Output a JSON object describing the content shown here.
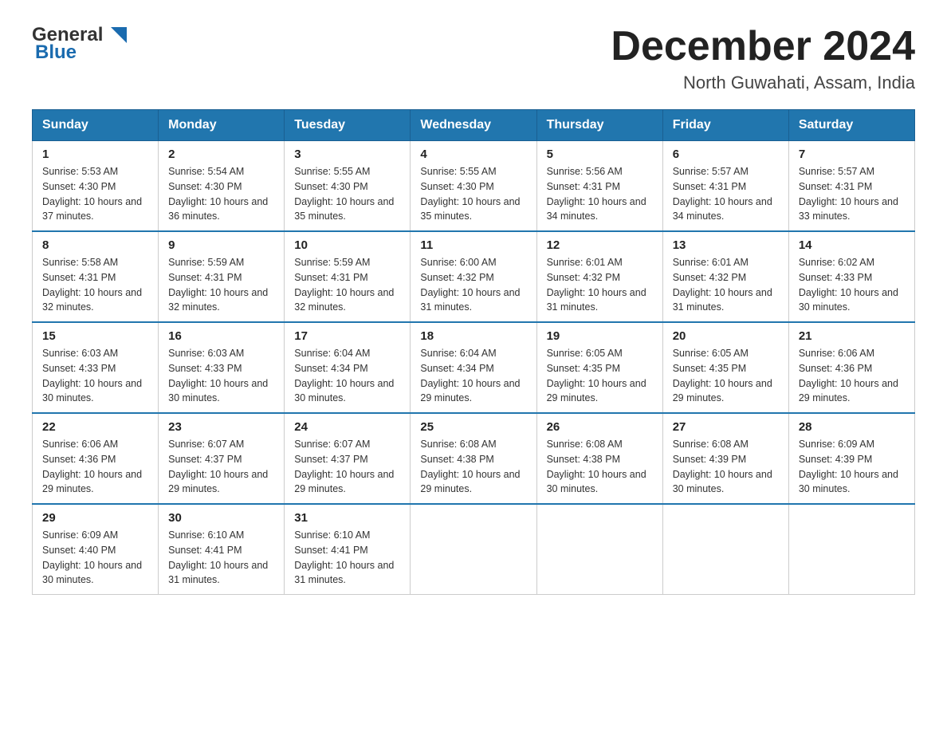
{
  "logo": {
    "general": "General",
    "blue": "Blue"
  },
  "header": {
    "month_year": "December 2024",
    "location": "North Guwahati, Assam, India"
  },
  "days_of_week": [
    "Sunday",
    "Monday",
    "Tuesday",
    "Wednesday",
    "Thursday",
    "Friday",
    "Saturday"
  ],
  "weeks": [
    [
      {
        "day": "1",
        "sunrise": "5:53 AM",
        "sunset": "4:30 PM",
        "daylight": "10 hours and 37 minutes."
      },
      {
        "day": "2",
        "sunrise": "5:54 AM",
        "sunset": "4:30 PM",
        "daylight": "10 hours and 36 minutes."
      },
      {
        "day": "3",
        "sunrise": "5:55 AM",
        "sunset": "4:30 PM",
        "daylight": "10 hours and 35 minutes."
      },
      {
        "day": "4",
        "sunrise": "5:55 AM",
        "sunset": "4:30 PM",
        "daylight": "10 hours and 35 minutes."
      },
      {
        "day": "5",
        "sunrise": "5:56 AM",
        "sunset": "4:31 PM",
        "daylight": "10 hours and 34 minutes."
      },
      {
        "day": "6",
        "sunrise": "5:57 AM",
        "sunset": "4:31 PM",
        "daylight": "10 hours and 34 minutes."
      },
      {
        "day": "7",
        "sunrise": "5:57 AM",
        "sunset": "4:31 PM",
        "daylight": "10 hours and 33 minutes."
      }
    ],
    [
      {
        "day": "8",
        "sunrise": "5:58 AM",
        "sunset": "4:31 PM",
        "daylight": "10 hours and 32 minutes."
      },
      {
        "day": "9",
        "sunrise": "5:59 AM",
        "sunset": "4:31 PM",
        "daylight": "10 hours and 32 minutes."
      },
      {
        "day": "10",
        "sunrise": "5:59 AM",
        "sunset": "4:31 PM",
        "daylight": "10 hours and 32 minutes."
      },
      {
        "day": "11",
        "sunrise": "6:00 AM",
        "sunset": "4:32 PM",
        "daylight": "10 hours and 31 minutes."
      },
      {
        "day": "12",
        "sunrise": "6:01 AM",
        "sunset": "4:32 PM",
        "daylight": "10 hours and 31 minutes."
      },
      {
        "day": "13",
        "sunrise": "6:01 AM",
        "sunset": "4:32 PM",
        "daylight": "10 hours and 31 minutes."
      },
      {
        "day": "14",
        "sunrise": "6:02 AM",
        "sunset": "4:33 PM",
        "daylight": "10 hours and 30 minutes."
      }
    ],
    [
      {
        "day": "15",
        "sunrise": "6:03 AM",
        "sunset": "4:33 PM",
        "daylight": "10 hours and 30 minutes."
      },
      {
        "day": "16",
        "sunrise": "6:03 AM",
        "sunset": "4:33 PM",
        "daylight": "10 hours and 30 minutes."
      },
      {
        "day": "17",
        "sunrise": "6:04 AM",
        "sunset": "4:34 PM",
        "daylight": "10 hours and 30 minutes."
      },
      {
        "day": "18",
        "sunrise": "6:04 AM",
        "sunset": "4:34 PM",
        "daylight": "10 hours and 29 minutes."
      },
      {
        "day": "19",
        "sunrise": "6:05 AM",
        "sunset": "4:35 PM",
        "daylight": "10 hours and 29 minutes."
      },
      {
        "day": "20",
        "sunrise": "6:05 AM",
        "sunset": "4:35 PM",
        "daylight": "10 hours and 29 minutes."
      },
      {
        "day": "21",
        "sunrise": "6:06 AM",
        "sunset": "4:36 PM",
        "daylight": "10 hours and 29 minutes."
      }
    ],
    [
      {
        "day": "22",
        "sunrise": "6:06 AM",
        "sunset": "4:36 PM",
        "daylight": "10 hours and 29 minutes."
      },
      {
        "day": "23",
        "sunrise": "6:07 AM",
        "sunset": "4:37 PM",
        "daylight": "10 hours and 29 minutes."
      },
      {
        "day": "24",
        "sunrise": "6:07 AM",
        "sunset": "4:37 PM",
        "daylight": "10 hours and 29 minutes."
      },
      {
        "day": "25",
        "sunrise": "6:08 AM",
        "sunset": "4:38 PM",
        "daylight": "10 hours and 29 minutes."
      },
      {
        "day": "26",
        "sunrise": "6:08 AM",
        "sunset": "4:38 PM",
        "daylight": "10 hours and 30 minutes."
      },
      {
        "day": "27",
        "sunrise": "6:08 AM",
        "sunset": "4:39 PM",
        "daylight": "10 hours and 30 minutes."
      },
      {
        "day": "28",
        "sunrise": "6:09 AM",
        "sunset": "4:39 PM",
        "daylight": "10 hours and 30 minutes."
      }
    ],
    [
      {
        "day": "29",
        "sunrise": "6:09 AM",
        "sunset": "4:40 PM",
        "daylight": "10 hours and 30 minutes."
      },
      {
        "day": "30",
        "sunrise": "6:10 AM",
        "sunset": "4:41 PM",
        "daylight": "10 hours and 31 minutes."
      },
      {
        "day": "31",
        "sunrise": "6:10 AM",
        "sunset": "4:41 PM",
        "daylight": "10 hours and 31 minutes."
      },
      null,
      null,
      null,
      null
    ]
  ],
  "labels": {
    "sunrise": "Sunrise:",
    "sunset": "Sunset:",
    "daylight": "Daylight:"
  }
}
